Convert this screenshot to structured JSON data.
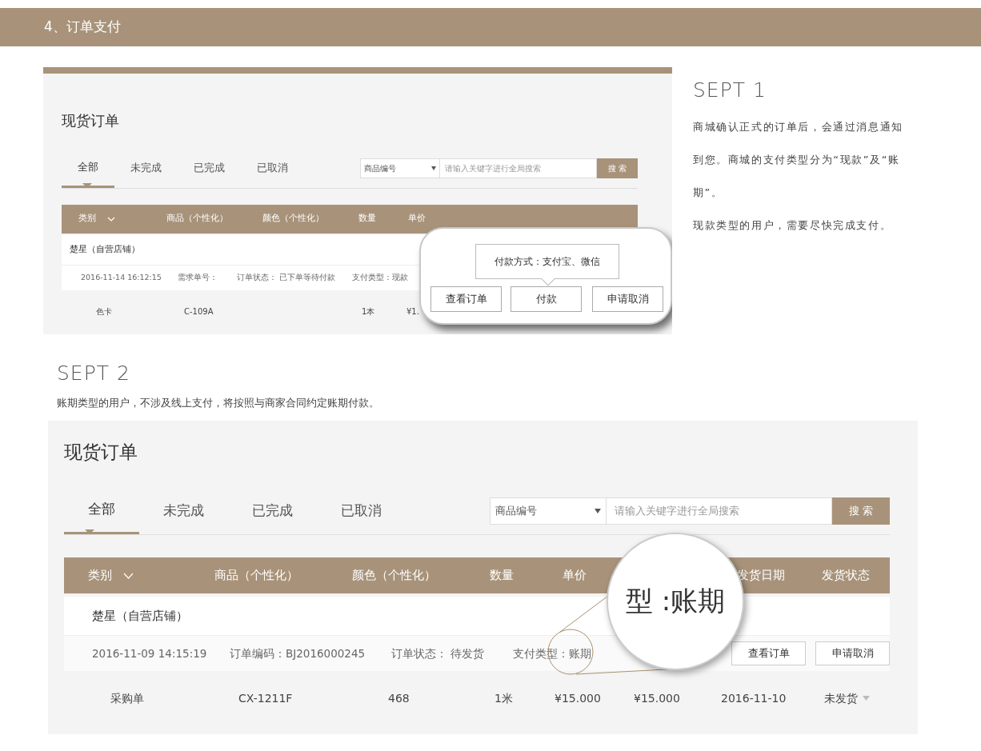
{
  "section_title": "4、订单支付",
  "step1": {
    "title": "SEPT 1",
    "paragraphs": [
      "商城确认正式的订单后，会通过消息通知到您。商城的支付类型分为“现款”及“账期”。",
      "现款类型的用户，需要尽快完成支付。"
    ],
    "screen": {
      "title": "现货订单",
      "tabs": [
        {
          "label": "全部",
          "selected": true
        },
        {
          "label": "未完成",
          "selected": false
        },
        {
          "label": "已完成",
          "selected": false
        },
        {
          "label": "已取消",
          "selected": false
        }
      ],
      "search": {
        "select": "商品编号",
        "placeholder": "请输入关键字进行全局搜索",
        "button": "搜 索"
      },
      "columns": [
        "类别",
        "商品（个性化）",
        "颜色（个性化）",
        "数量",
        "单价"
      ],
      "store": "楚星（自营店铺）",
      "order": {
        "fields": [
          "2016-11-14 16:12:15",
          "需求单号：",
          "订单状态： 已下单等待付款",
          "支付类型：现款"
        ]
      },
      "items": [
        {
          "cells": [
            "色卡",
            "C-109A",
            null,
            "1本",
            "¥1."
          ]
        }
      ],
      "callout": {
        "tooltip": "付款方式：支付宝、微信",
        "buttons": [
          "查看订单",
          "付款",
          "申请取消"
        ]
      }
    }
  },
  "step2": {
    "title": "SEPT 2",
    "paragraphs": [
      "账期类型的用户，不涉及线上支付，将按照与商家合同约定账期付款。"
    ],
    "screen": {
      "title": "现货订单",
      "tabs": [
        {
          "label": "全部",
          "selected": true
        },
        {
          "label": "未完成",
          "selected": false
        },
        {
          "label": "已完成",
          "selected": false
        },
        {
          "label": "已取消",
          "selected": false
        }
      ],
      "search": {
        "select": "商品编号",
        "placeholder": "请输入关键字进行全局搜索",
        "button": "搜 索"
      },
      "columns": [
        "类别",
        "商品（个性化）",
        "颜色（个性化）",
        "数量",
        "单价",
        null,
        "发货日期",
        "发货状态"
      ],
      "store": "楚星（自营店铺）",
      "order": {
        "fields": [
          "2016-11-09 14:15:19",
          "订单编码：BJ2016000245",
          "订单状态： 待发货",
          "支付类型：账期"
        ],
        "buttons": [
          "查看订单",
          "申请取消"
        ]
      },
      "items": [
        {
          "cells": [
            "采购单",
            "CX-1211F",
            "468",
            "1米",
            "¥15.000",
            "¥15.000",
            "2016-11-10",
            "未发货"
          ]
        }
      ],
      "magnifier": {
        "text": "型 :账期"
      }
    }
  }
}
